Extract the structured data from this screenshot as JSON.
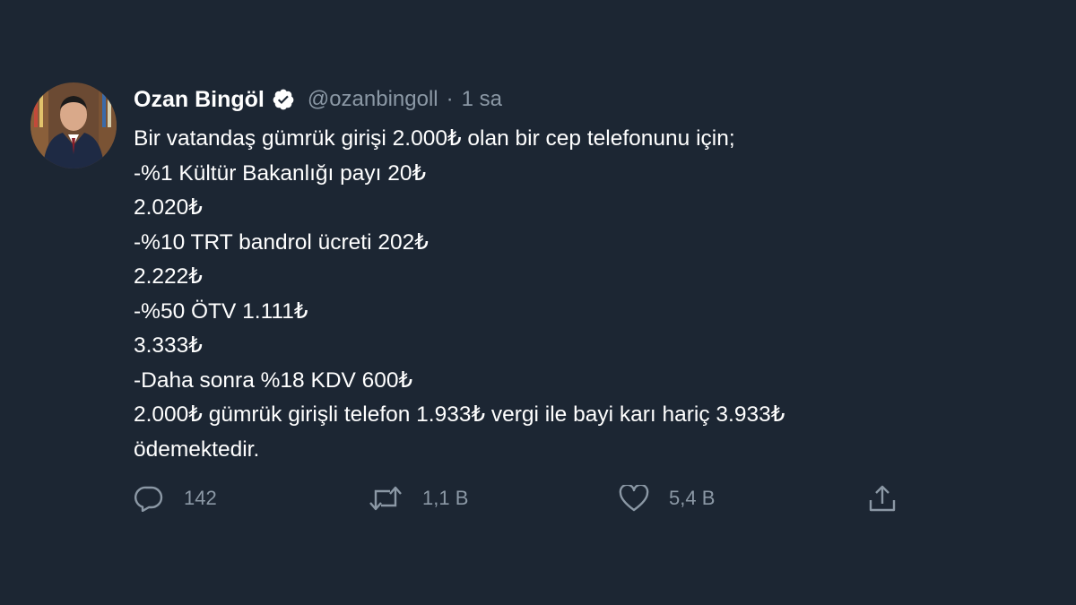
{
  "author": {
    "name": "Ozan Bingöl",
    "handle": "@ozanbingoll",
    "separator": "·",
    "time": "1 sa",
    "verified": true,
    "avatar_icon": "profile-photo"
  },
  "tweet": {
    "lines": [
      "Bir vatandaş gümrük girişi 2.000₺ olan bir cep telefonunu için;",
      "-%1 Kültür Bakanlığı payı 20₺",
      "2.020₺",
      "-%10 TRT bandrol ücreti 202₺",
      "2.222₺",
      "-%50 ÖTV 1.111₺",
      "3.333₺",
      "-Daha sonra %18 KDV 600₺",
      "2.000₺ gümrük girişli telefon 1.933₺ vergi ile bayi karı hariç 3.933₺",
      "ödemektedir."
    ]
  },
  "actions": {
    "reply": {
      "icon": "reply-icon",
      "count": "142"
    },
    "retweet": {
      "icon": "retweet-icon",
      "count": "1,1 B"
    },
    "like": {
      "icon": "heart-icon",
      "count": "5,4 B"
    },
    "share": {
      "icon": "share-icon",
      "count": ""
    }
  },
  "colors": {
    "background": "#1c2633",
    "text": "#ffffff",
    "secondary": "#8b98a5"
  }
}
